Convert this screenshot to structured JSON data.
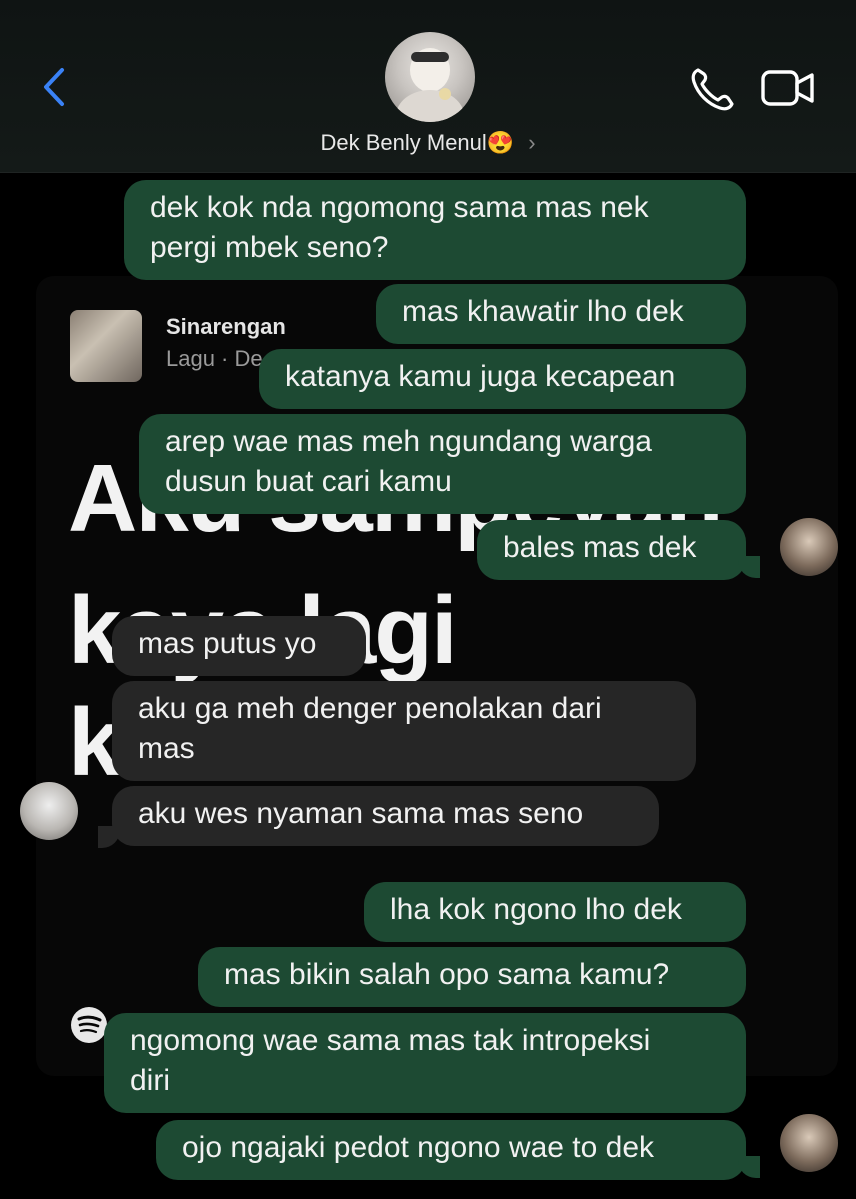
{
  "header": {
    "contact_name": "Dek Benly Menul😍",
    "chevron": "›",
    "icons": {
      "back": "back-chevron-icon",
      "call": "phone-icon",
      "video": "video-camera-icon"
    },
    "accent_color": "#3a82f6"
  },
  "shared_song": {
    "title": "Sinarengan",
    "subtitle": "Lagu · De",
    "lyrics": [
      "Aku sampeyan",
      "kaya lagi",
      "k"
    ]
  },
  "messages": [
    {
      "side": "out",
      "lines": [
        "dek kok nda ngomong sama mas nek",
        "pergi mbek seno?"
      ]
    },
    {
      "side": "out",
      "lines": [
        "mas khawatir lho dek"
      ]
    },
    {
      "side": "out",
      "lines": [
        "katanya kamu juga kecapean"
      ]
    },
    {
      "side": "out",
      "lines": [
        "arep wae mas meh ngundang warga",
        "dusun buat cari kamu"
      ]
    },
    {
      "side": "out",
      "lines": [
        "bales mas dek"
      ]
    },
    {
      "side": "in",
      "lines": [
        "mas putus yo"
      ]
    },
    {
      "side": "in",
      "lines": [
        "aku ga meh denger penolakan dari",
        "mas"
      ]
    },
    {
      "side": "in",
      "lines": [
        "aku wes nyaman sama mas seno"
      ]
    },
    {
      "side": "out",
      "lines": [
        "lha kok ngono lho dek"
      ]
    },
    {
      "side": "out",
      "lines": [
        "mas bikin salah opo sama kamu?"
      ]
    },
    {
      "side": "out",
      "lines": [
        "ngomong wae sama mas tak intropeksi",
        "diri"
      ]
    },
    {
      "side": "out",
      "lines": [
        "ojo ngajaki pedot ngono wae to dek"
      ]
    }
  ],
  "colors": {
    "outgoing": "#1d4a33",
    "incoming": "#262626",
    "background": "#000000"
  }
}
